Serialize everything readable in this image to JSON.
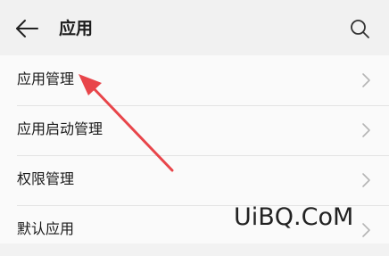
{
  "header": {
    "title": "应用",
    "back_icon": "back-arrow-icon",
    "search_icon": "search-icon"
  },
  "list": {
    "items": [
      {
        "label": "应用管理",
        "icon": "chevron-right-icon"
      },
      {
        "label": "应用启动管理",
        "icon": "chevron-right-icon"
      },
      {
        "label": "权限管理",
        "icon": "chevron-right-icon"
      },
      {
        "label": "默认应用",
        "icon": "chevron-right-icon"
      }
    ]
  },
  "annotation": {
    "arrow_color": "#e8454a",
    "target": "应用管理"
  },
  "watermark": {
    "text": "UiBQ.CoM"
  }
}
